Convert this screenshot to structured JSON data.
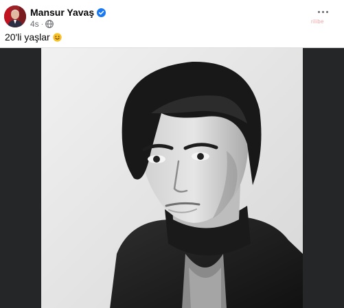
{
  "post": {
    "author_name": "Mansur Yavaş",
    "time_ago": "4s",
    "separator": "·",
    "text": "20'li yaşlar",
    "watermark": "rilibe"
  },
  "icons": {
    "verified": "verified-badge-icon",
    "privacy": "globe-icon",
    "emoji": "smiling-face-emoji-icon",
    "menu": "more-options-icon"
  },
  "colors": {
    "author_text": "#050505",
    "meta_text": "#65676b",
    "verified_blue": "#1877f2",
    "media_background": "#252627"
  }
}
